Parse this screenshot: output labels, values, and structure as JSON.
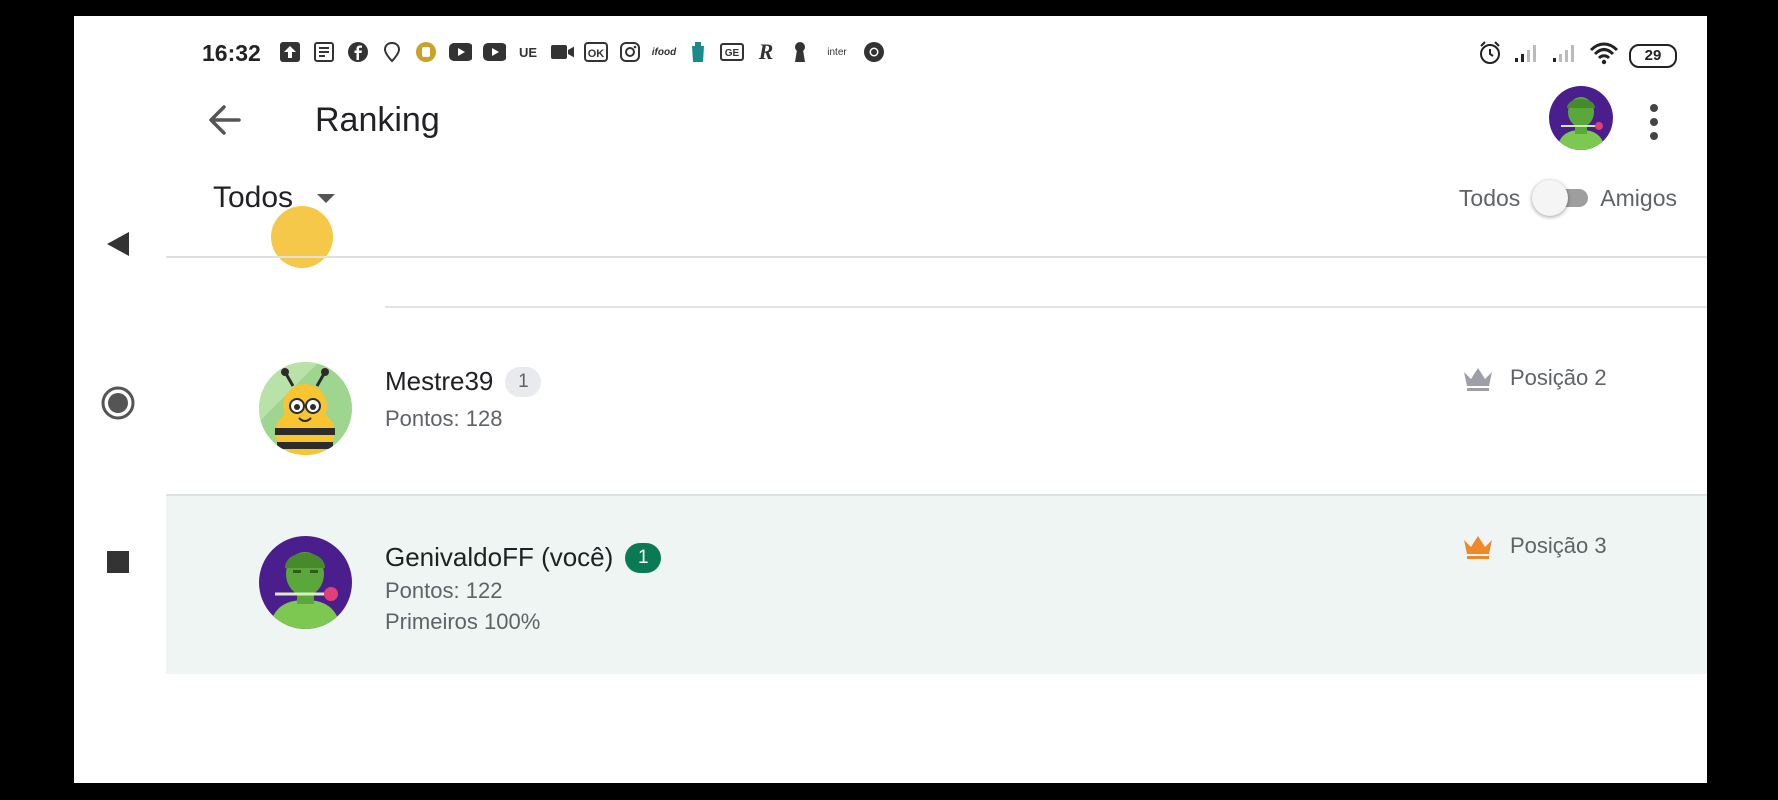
{
  "status_bar": {
    "time": "16:32",
    "notification_icons": [
      "upload-icon",
      "news-icon",
      "facebook-icon",
      "maps-pin-icon",
      "coin-icon",
      "youtube-icon",
      "youtube-icon",
      "ue-icon",
      "video-camera-icon",
      "ok-icon",
      "instagram-icon",
      "ifood-icon",
      "drink-icon",
      "ge-icon",
      "r-icon",
      "keyhole-icon",
      "inter-icon",
      "chrome-icon"
    ],
    "ue_label": "UE",
    "ifood_label": "ifood",
    "ge_label": "GE",
    "r_label": "R",
    "inter_label": "inter",
    "battery": "29"
  },
  "app_bar": {
    "title": "Ranking"
  },
  "filter": {
    "selected": "Todos"
  },
  "toggle": {
    "left_label": "Todos",
    "right_label": "Amigos",
    "on": false
  },
  "entries": [
    {
      "name": "Mestre39",
      "badge": "1",
      "points": "Pontos: 128",
      "position": "Posição 2",
      "crown_color": "#9e9ea6",
      "is_you": false
    },
    {
      "name": "GenivaldoFF (você)",
      "badge": "1",
      "points": "Pontos: 122",
      "extra": "Primeiros 100%",
      "position": "Posição 3",
      "crown_color": "#f0882a",
      "is_you": true
    }
  ],
  "colors": {
    "highlight_row": "#eff5f3",
    "badge_green": "#0a7a55",
    "avatar_purple": "#4b1e8e"
  }
}
